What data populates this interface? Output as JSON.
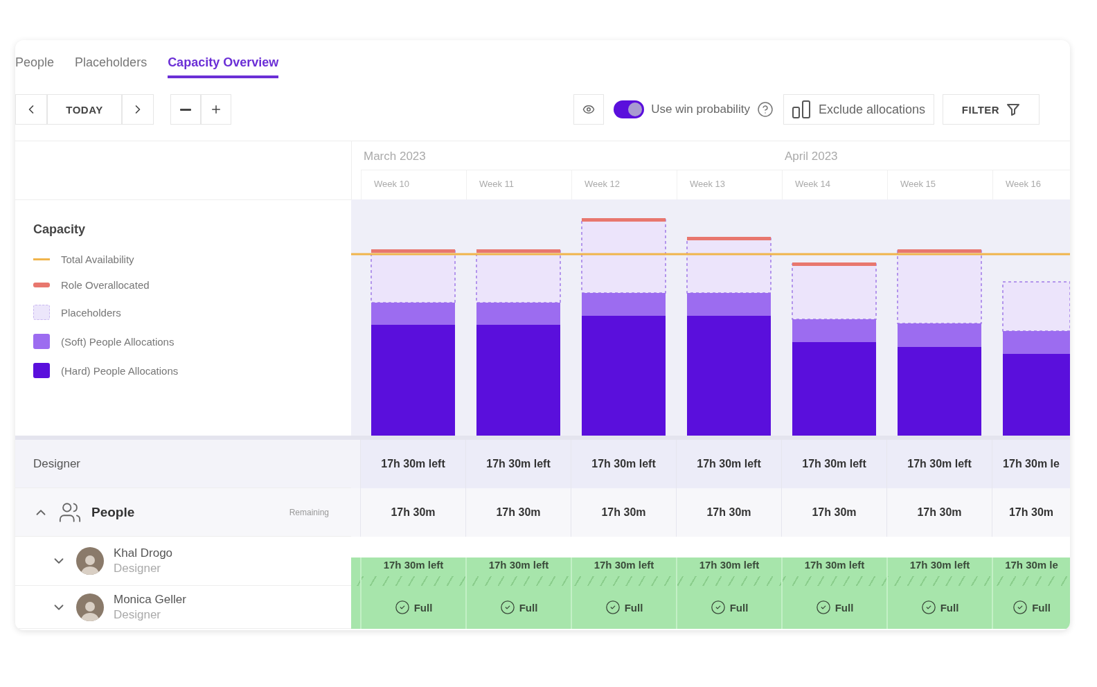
{
  "tabs": [
    {
      "label": "People",
      "selected": false
    },
    {
      "label": "Placeholders",
      "selected": false
    },
    {
      "label": "Capacity Overview",
      "selected": true
    }
  ],
  "toolbar": {
    "today": "TODAY",
    "win_probability": {
      "label": "Use win probability",
      "on": true
    },
    "exclude": "Exclude allocations",
    "filter": "FILTER"
  },
  "timeline": {
    "months": [
      {
        "label": "March 2023",
        "weeks": [
          "Week 10",
          "Week 11",
          "Week 12",
          "Week 13"
        ]
      },
      {
        "label": "April 2023",
        "weeks": [
          "Week 14",
          "Week 15",
          "Week 16"
        ]
      }
    ]
  },
  "legend": {
    "title": "Capacity",
    "items": [
      {
        "label": "Total Availability",
        "kind": "line",
        "color": "#f0b54c"
      },
      {
        "label": "Role Overallocated",
        "kind": "bar",
        "color": "#e8776e"
      },
      {
        "label": "Placeholders",
        "kind": "dashed",
        "color": "#ece6fb"
      },
      {
        "label": "(Soft) People Allocations",
        "kind": "swatch",
        "color": "#9c6cf0"
      },
      {
        "label": "(Hard) People Allocations",
        "kind": "swatch",
        "color": "#5a0fdc"
      }
    ]
  },
  "role_row": {
    "label": "Designer",
    "cells": [
      "17h 30m left",
      "17h 30m left",
      "17h 30m left",
      "17h 30m left",
      "17h 30m left",
      "17h 30m left",
      "17h 30m le"
    ]
  },
  "people_group": {
    "label": "People",
    "expanded": true,
    "remaining_label": "Remaining",
    "cells": [
      "17h 30m",
      "17h 30m",
      "17h 30m",
      "17h 30m",
      "17h 30m",
      "17h 30m",
      "17h 30m"
    ]
  },
  "people": [
    {
      "name": "Khal Drogo",
      "role": "Designer",
      "expanded": false,
      "kind": "hours",
      "cells": [
        "17h 30m left",
        "17h 30m left",
        "17h 30m left",
        "17h 30m left",
        "17h 30m left",
        "17h 30m left",
        "17h 30m le"
      ]
    },
    {
      "name": "Monica Geller",
      "role": "Designer",
      "expanded": false,
      "kind": "full",
      "cells": [
        "Full",
        "Full",
        "Full",
        "Full",
        "Full",
        "Full",
        "Full"
      ]
    }
  ]
}
